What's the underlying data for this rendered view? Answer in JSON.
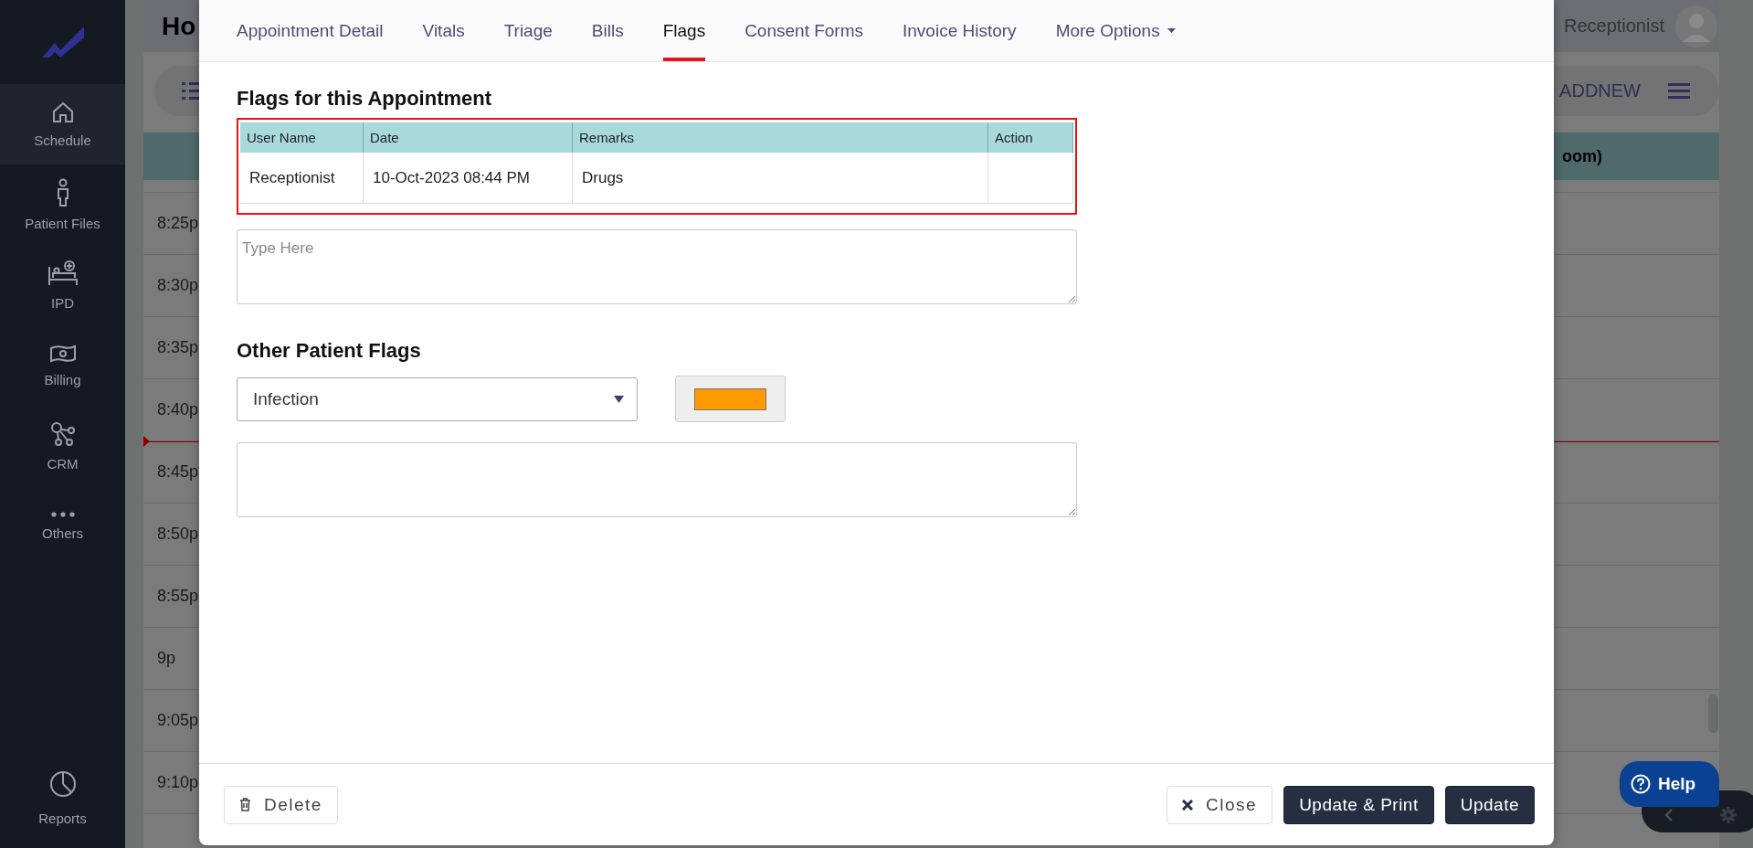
{
  "sidebar": {
    "items": [
      {
        "label": "Schedule",
        "selected": true
      },
      {
        "label": "Patient Files",
        "selected": false
      },
      {
        "label": "IPD",
        "selected": false
      },
      {
        "label": "Billing",
        "selected": false
      },
      {
        "label": "CRM",
        "selected": false
      },
      {
        "label": "Others",
        "selected": false
      }
    ],
    "footer_item": {
      "label": "Reports"
    }
  },
  "background": {
    "title": "Ho",
    "user": "Receptionist",
    "toolbar_action": "ADDNEW",
    "column_heading": "oom)",
    "times": [
      "8:25p",
      "8:30p",
      "8:35p",
      "8:40p",
      "8:45p",
      "8:50p",
      "8:55p",
      "9p",
      "9:05p",
      "9:10p"
    ]
  },
  "modal": {
    "tabs": [
      {
        "label": "Appointment Detail",
        "kind": "link",
        "selected": false
      },
      {
        "label": "Vitals",
        "kind": "link",
        "selected": false
      },
      {
        "label": "Triage",
        "kind": "link",
        "selected": false
      },
      {
        "label": "Bills",
        "kind": "link",
        "selected": false
      },
      {
        "label": "Flags",
        "kind": "link",
        "selected": true
      },
      {
        "label": "Consent Forms",
        "kind": "link",
        "selected": false
      },
      {
        "label": "Invoice History",
        "kind": "link",
        "selected": false
      },
      {
        "label": "More Options",
        "kind": "dropdown",
        "selected": false
      }
    ],
    "appointment_flags": {
      "title": "Flags for this Appointment",
      "columns": [
        "User Name",
        "Date",
        "Remarks",
        "Action"
      ],
      "rows": [
        [
          "Receptionist",
          "10-Oct-2023 08:44 PM",
          "Drugs",
          ""
        ]
      ],
      "remark_field": {
        "placeholder": "Type Here"
      }
    },
    "patient_flags": {
      "title": "Other Patient Flags",
      "flag_select": {
        "value": "Infection"
      },
      "color": "#ff9900"
    },
    "footer": {
      "left_buttons": [
        "Delete"
      ],
      "right_buttons": [
        {
          "label": "Close",
          "kind": "plain"
        },
        {
          "label": "Update & Print",
          "kind": "primary"
        },
        {
          "label": "Update",
          "kind": "primary"
        }
      ]
    }
  },
  "help": {
    "label": "Help"
  }
}
